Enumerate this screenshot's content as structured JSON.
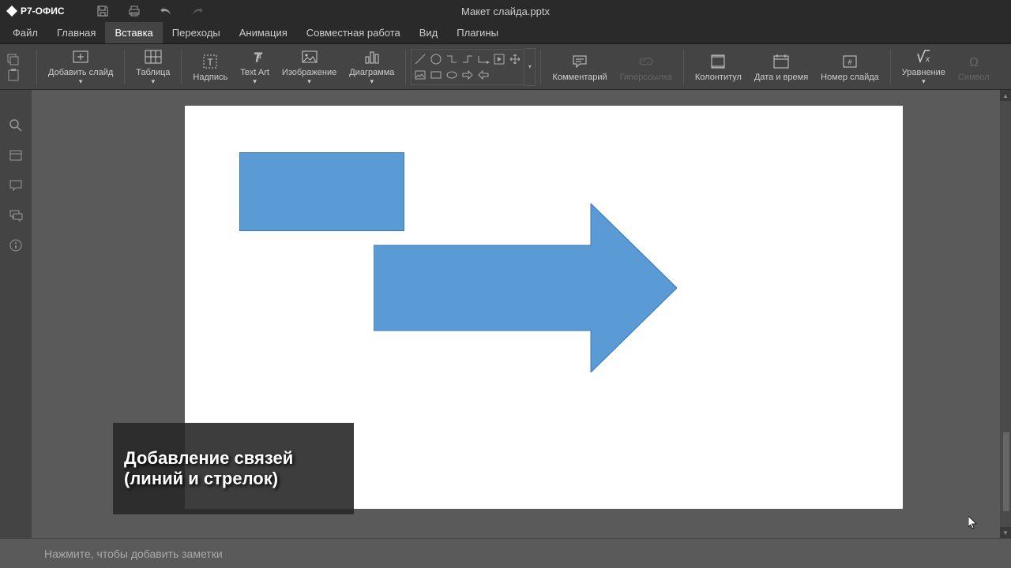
{
  "app": {
    "name": "Р7-ОФИС",
    "doc_title": "Макет слайда.pptx"
  },
  "menubar": {
    "items": [
      {
        "label": "Файл"
      },
      {
        "label": "Главная"
      },
      {
        "label": "Вставка",
        "active": true
      },
      {
        "label": "Переходы"
      },
      {
        "label": "Анимация"
      },
      {
        "label": "Совместная работа"
      },
      {
        "label": "Вид"
      },
      {
        "label": "Плагины"
      }
    ]
  },
  "toolbar": {
    "add_slide": "Добавить слайд",
    "table": "Таблица",
    "textbox": "Надпись",
    "textart": "Text Art",
    "image": "Изображение",
    "chart": "Диаграмма",
    "comment": "Комментарий",
    "hyperlink": "Гиперссылка",
    "header_footer": "Колонтитул",
    "date_time": "Дата и время",
    "slide_number": "Номер слайда",
    "equation": "Уравнение",
    "symbol": "Символ"
  },
  "tooltip": {
    "line1": "Добавление связей",
    "line2": "(линий и стрелок)"
  },
  "notes": {
    "placeholder": "Нажмите, чтобы добавить заметки"
  },
  "colors": {
    "shape_fill": "#5b9bd5",
    "shape_stroke": "#3a78b5"
  }
}
